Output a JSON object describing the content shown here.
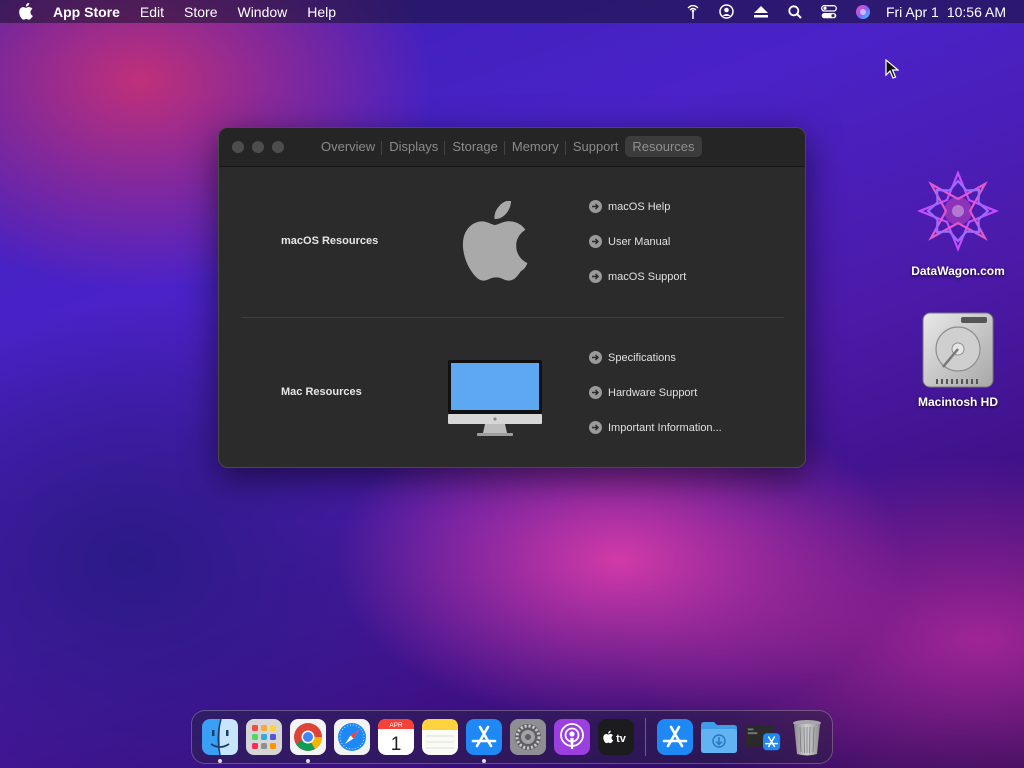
{
  "menubar": {
    "app_name": "App Store",
    "menus": [
      "Edit",
      "Store",
      "Window",
      "Help"
    ],
    "status_icons": [
      "wifi-antenna-icon",
      "user-icon",
      "eject-icon",
      "search-icon",
      "control-center-icon",
      "siri-icon"
    ],
    "date": "Fri Apr 1",
    "time": "10:56 AM"
  },
  "window": {
    "tabs": [
      "Overview",
      "Displays",
      "Storage",
      "Memory",
      "Support",
      "Resources"
    ],
    "active_tab": "Resources",
    "sections": [
      {
        "title": "macOS Resources",
        "icon": "apple-logo-icon",
        "links": [
          "macOS Help",
          "User Manual",
          "macOS Support"
        ]
      },
      {
        "title": "Mac Resources",
        "icon": "imac-icon",
        "links": [
          "Specifications",
          "Hardware Support",
          "Important Information..."
        ]
      }
    ]
  },
  "desktop": {
    "icons": [
      {
        "label": "DataWagon.com",
        "icon": "datawagon-star-icon"
      },
      {
        "label": "Macintosh HD",
        "icon": "hard-drive-icon"
      }
    ]
  },
  "calendar_icon": {
    "month": "APR",
    "day": "1"
  },
  "dock": {
    "apps": [
      {
        "name": "finder",
        "running": true
      },
      {
        "name": "launchpad",
        "running": false
      },
      {
        "name": "chrome",
        "running": true
      },
      {
        "name": "safari",
        "running": false
      },
      {
        "name": "calendar",
        "running": false
      },
      {
        "name": "notes",
        "running": false
      },
      {
        "name": "app-store",
        "running": true
      },
      {
        "name": "system-preferences",
        "running": false
      },
      {
        "name": "podcasts",
        "running": false
      },
      {
        "name": "apple-tv",
        "running": false
      }
    ],
    "tv_label": "tv",
    "extras": [
      "app-store-installer",
      "downloads-folder",
      "installer-stack",
      "trash"
    ]
  },
  "colors": {
    "window_bg": "#2b2b2b",
    "accent_blue": "#1e88f5"
  }
}
